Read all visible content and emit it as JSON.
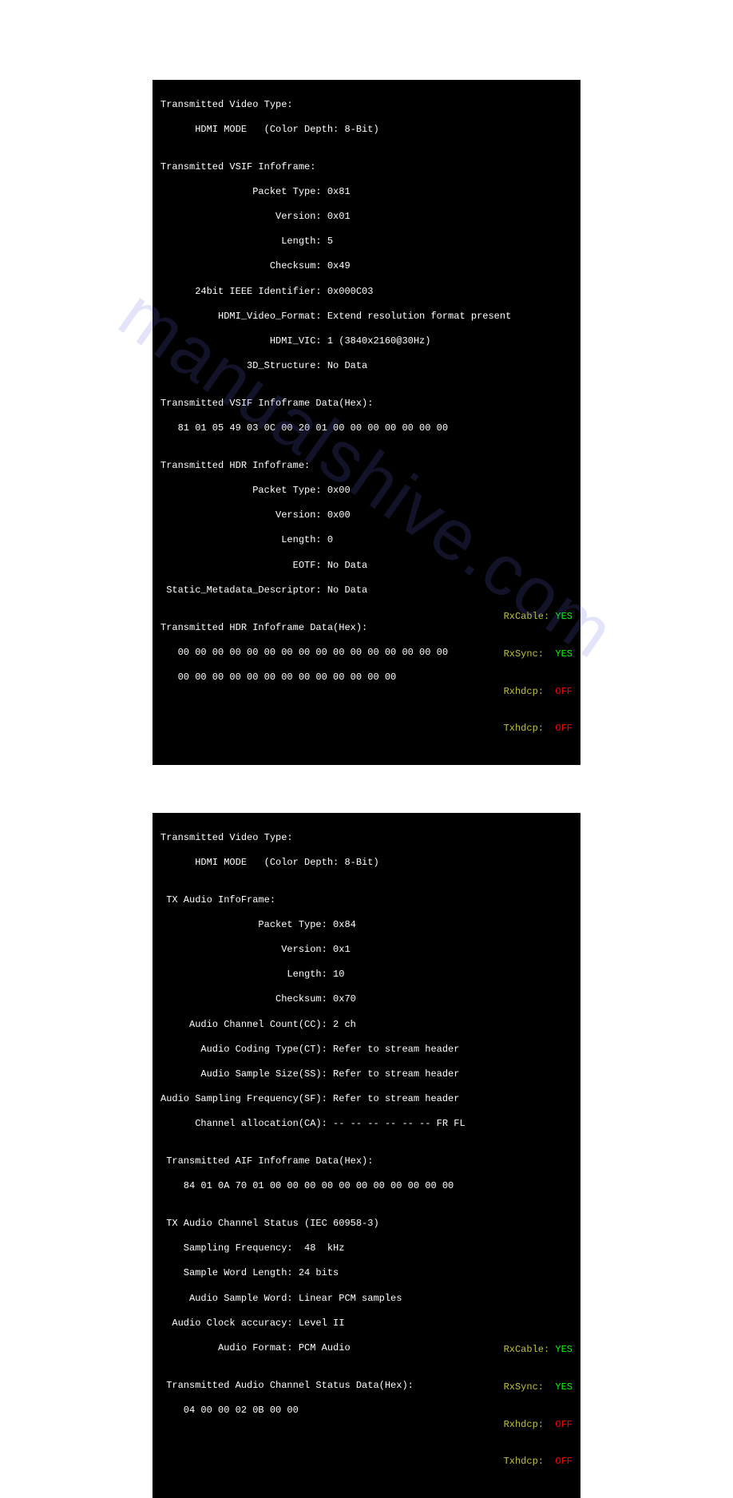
{
  "watermark": "manualshive.com",
  "panel1": {
    "header1": "Transmitted Video Type:",
    "mode": "      HDMI MODE   (Color Depth: 8-Bit)",
    "blank": "",
    "header2": "Transmitted VSIF Infoframe:",
    "f1": "                Packet Type: 0x81",
    "f2": "                    Version: 0x01",
    "f3": "                     Length: 5",
    "f4": "                   Checksum: 0x49",
    "f5": "      24bit IEEE Identifier: 0x000C03",
    "f6": "          HDMI_Video_Format: Extend resolution format present",
    "f7": "                   HDMI_VIC: 1 (3840x2160@30Hz)",
    "f8": "               3D_Structure: No Data",
    "header3": "Transmitted VSIF Infoframe Data(Hex):",
    "hex1": "   81 01 05 49 03 0C 00 20 01 00 00 00 00 00 00 00",
    "header4": "Transmitted HDR Infoframe:",
    "h1": "                Packet Type: 0x00",
    "h2": "                    Version: 0x00",
    "h3": "                     Length: 0",
    "h4": "                       EOTF: No Data",
    "h5": " Static_Metadata_Descriptor: No Data",
    "header5": "Transmitted HDR Infoframe Data(Hex):",
    "hex2a": "   00 00 00 00 00 00 00 00 00 00 00 00 00 00 00 00",
    "hex2b": "   00 00 00 00 00 00 00 00 00 00 00 00 00",
    "status": {
      "rxcable_l": "RxCable:",
      "rxcable_v": "YES",
      "rxsync_l": "RxSync: ",
      "rxsync_v": "YES",
      "rxhdcp_l": "Rxhdcp: ",
      "rxhdcp_v": "OFF",
      "txhdcp_l": "Txhdcp: ",
      "txhdcp_v": "OFF"
    }
  },
  "panel2": {
    "header1": "Transmitted Video Type:",
    "mode": "      HDMI MODE   (Color Depth: 8-Bit)",
    "blank": "",
    "header2": " TX Audio InfoFrame:",
    "f1": "                 Packet Type: 0x84",
    "f2": "                     Version: 0x1",
    "f3": "                      Length: 10",
    "f4": "                    Checksum: 0x70",
    "f5": "     Audio Channel Count(CC): 2 ch",
    "f6": "       Audio Coding Type(CT): Refer to stream header",
    "f7": "       Audio Sample Size(SS): Refer to stream header",
    "f8": "Audio Sampling Frequency(SF): Refer to stream header",
    "f9": "      Channel allocation(CA): -- -- -- -- -- -- FR FL",
    "header3": " Transmitted AIF Infoframe Data(Hex):",
    "hex1": "    84 01 0A 70 01 00 00 00 00 00 00 00 00 00 00 00",
    "header4": " TX Audio Channel Status (IEC 60958-3)",
    "c1": "    Sampling Frequency:  48  kHz",
    "c2": "    Sample Word Length: 24 bits",
    "c3": "     Audio Sample Word: Linear PCM samples",
    "c4": "  Audio Clock accuracy: Level II",
    "c5": "          Audio Format: PCM Audio",
    "header5": " Transmitted Audio Channel Status Data(Hex):",
    "hex2": "    04 00 00 02 0B 00 00",
    "status": {
      "rxcable_l": "RxCable:",
      "rxcable_v": "YES",
      "rxsync_l": "RxSync: ",
      "rxsync_v": "YES",
      "rxhdcp_l": "Rxhdcp: ",
      "rxhdcp_v": "OFF",
      "txhdcp_l": "Txhdcp: ",
      "txhdcp_v": "OFF"
    }
  }
}
